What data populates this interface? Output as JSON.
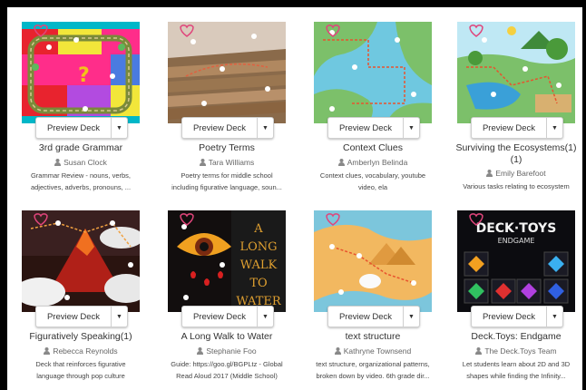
{
  "preview_label": "Preview Deck",
  "decks": [
    {
      "title": "3rd grade Grammar",
      "author": "Susan Clock",
      "desc1": "Grammar Review - nouns, verbs,",
      "desc2": "adjectives, adverbs, pronouns, ..."
    },
    {
      "title": "Poetry Terms",
      "author": "Tara Williams",
      "desc1": "Poetry terms for middle school",
      "desc2": "including figurative language, soun..."
    },
    {
      "title": "Context Clues",
      "author": "Amberlyn Belinda",
      "desc1": "Context clues, vocabulary, youtube",
      "desc2": "video, ela"
    },
    {
      "title": "Surviving the Ecosystems(1)",
      "title_line2": "(1)",
      "author": "Emily Barefoot",
      "desc1": "Various tasks relating to ecosystem",
      "desc2": ""
    },
    {
      "title": "Figuratively Speaking(1)",
      "author": "Rebecca Reynolds",
      "desc1": "Deck that reinforces figurative",
      "desc2": "language through pop culture"
    },
    {
      "title": "A Long Walk to Water",
      "author": "Stephanie Foo",
      "desc1": "Guide: https://goo.gl/BGPLtz - Global",
      "desc2": "Read Aloud 2017 (Middle School)"
    },
    {
      "title": "text structure",
      "author": "Kathryne Townsend",
      "desc1": "text structure, organizational patterns,",
      "desc2": "broken down by video. 6th grade dir..."
    },
    {
      "title": "Deck.Toys: Endgame",
      "author": "The Deck.Toys Team",
      "desc1": "Let students learn about 2D and 3D",
      "desc2": "shapes while finding the Infinity..."
    }
  ],
  "thumb_text": {
    "long_walk_1": "A",
    "long_walk_2": "LONG",
    "long_walk_3": "WALK",
    "long_walk_4": "TO",
    "long_walk_5": "WATER",
    "endgame_1": "DECK·TOYS",
    "endgame_2": "ENDGAME"
  },
  "colors": {
    "author_icon": "#888888",
    "heart": "#e0457b"
  }
}
